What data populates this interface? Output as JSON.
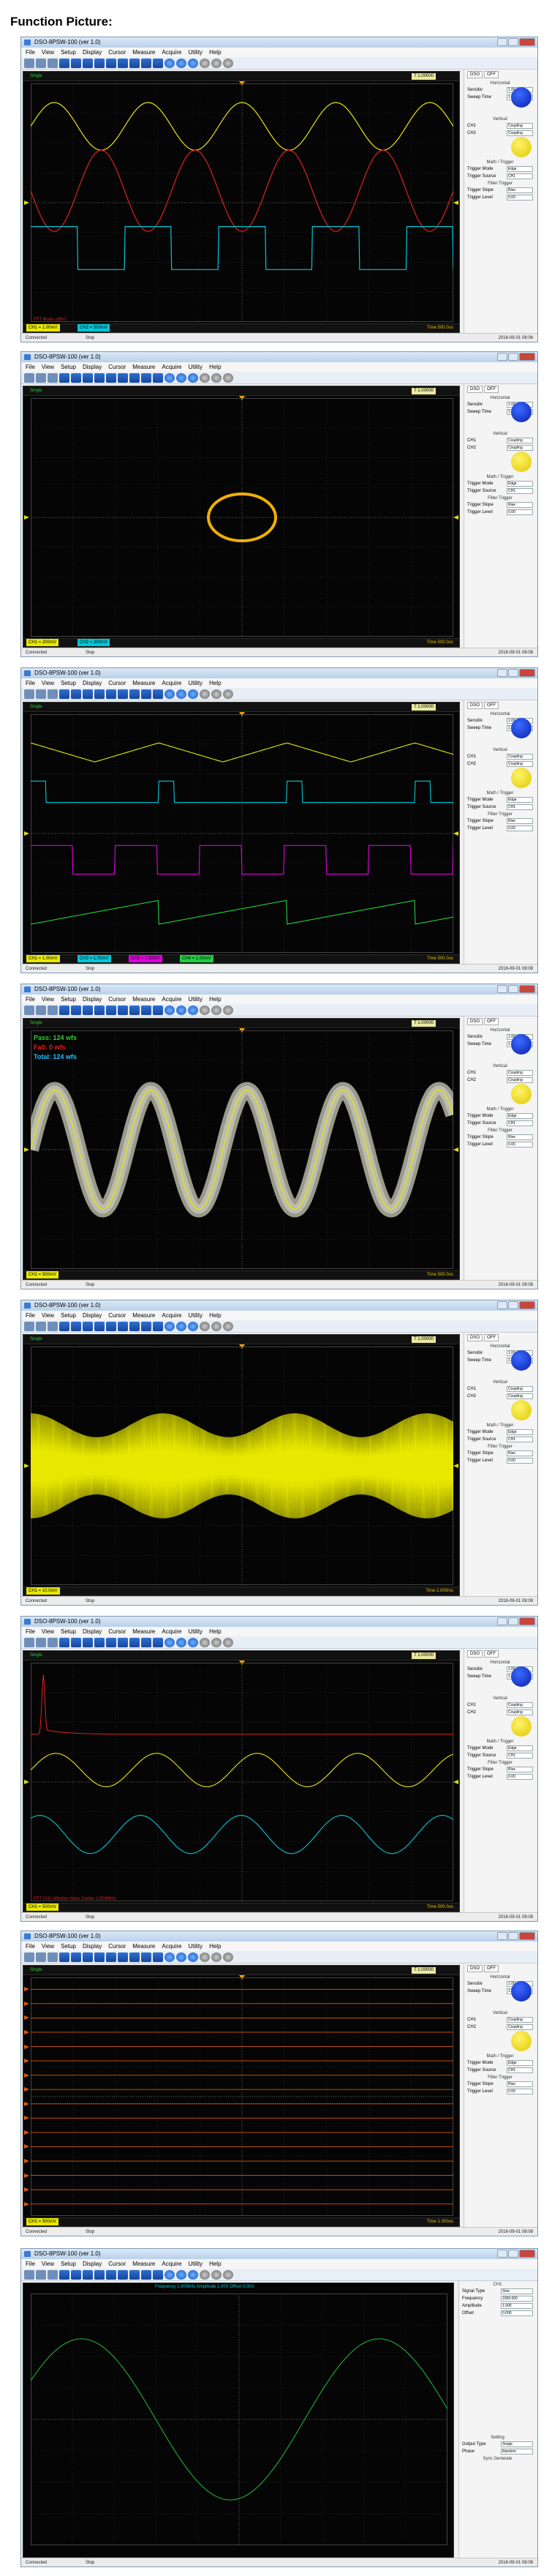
{
  "page": {
    "title": "Function Picture:"
  },
  "app": {
    "window_title": "DSO-8PSW-100 (ver 1.0)",
    "menu": [
      "File",
      "View",
      "Setup",
      "Display",
      "Cursor",
      "Measure",
      "Acquire",
      "Utility",
      "Help"
    ],
    "status": {
      "left": "Connected",
      "middle": "Stop",
      "right": "2016-09-01 08:08"
    },
    "panel": {
      "tabs": [
        "DSO",
        "OFF"
      ],
      "horizontal": "Horizontal",
      "sensitivity_label": "Sensitiv",
      "sensitivity_value": "1.00 us",
      "sweep_label": "Sweep Time",
      "sweep_value": "1.00us",
      "vertical": "Vertical",
      "ch1": "CH1",
      "ch2": "CH2",
      "coupling": "Coupling",
      "math": "Math / Trigger",
      "trigger_mode_label": "Trigger Mode",
      "trigger_mode_value": "Edge",
      "trigger_source_label": "Trigger Source",
      "trigger_source_value": "CH1",
      "filter": "Filter Trigger",
      "trigger_slope_label": "Trigger Slope",
      "trigger_slope_value": "Rise",
      "trigger_level_label": "Trigger Level",
      "trigger_level_value": "0.00"
    },
    "colors": {
      "ch1": "#e8e800",
      "ch2": "#00c8d8",
      "ch3": "#e000e0",
      "ch4": "#20d040",
      "red": "#e02020",
      "grid": "#3a3a3a",
      "digital": "#e05a00"
    }
  },
  "screens": [
    {
      "name": "multi-channel",
      "trig_mode": "Single",
      "trig_info": "T 1.00000",
      "ch1_label": "CH1 = 1.00mV",
      "ch2_label": "CH2 = 500mV",
      "time": "Time 500.0us",
      "overlay": "FFT Mode (dBV)"
    },
    {
      "name": "xy-mode",
      "trig_mode": "Single",
      "trig_info": "T 1.00000",
      "ch1_label": "CH1 = 200mV",
      "ch2_label": "CH2 = 200mV",
      "time": "Time 500.0us"
    },
    {
      "name": "four-channel",
      "trig_mode": "Single",
      "trig_info": "T 1.00000",
      "ch1_label": "CH1 = 1.00mV",
      "ch2_label": "CH2 = 1.00mV",
      "ch3_label": "CH3 = 1.00mV",
      "ch4_label": "CH4 = 1.00mV",
      "time": "Time 500.0us"
    },
    {
      "name": "persistence",
      "trig_mode": "Single",
      "trig_info": "T 1.00000",
      "ch1_label": "CH1 = 500mV",
      "time": "Time 500.0us",
      "meas1": "Pass: 124 wfs",
      "meas2": "Fail: 0 wfs",
      "meas3": "Total: 124 wfs"
    },
    {
      "name": "modulated",
      "trig_mode": "Single",
      "trig_info": "T 1.00000",
      "ch1_label": "CH1 = 10.0mV",
      "time": "Time 2.000ms"
    },
    {
      "name": "fft",
      "trig_mode": "Single",
      "trig_info": "T 1.00000",
      "ch1_label": "CH1 = 500mV",
      "time": "Time 500.0us",
      "overlay": "FFT CH1  Window Hann  Center 2.500MHz"
    },
    {
      "name": "logic",
      "trig_mode": "Single",
      "trig_info": "T 1.00000",
      "ch1_label": "CH1 = 500mV",
      "time": "Time 1.000us"
    },
    {
      "name": "generator",
      "gen_title": "Frequency 1.000kHz  Amplitude 1.00V  Offset 0.00V",
      "gen": {
        "ch": "CH1",
        "wave_label": "Signal Type",
        "wave_value": "Sine",
        "freq_label": "Frequency",
        "freq_value": "1000.000",
        "amp_label": "Amplitude",
        "amp_value": "1.000",
        "offset_label": "Offset",
        "offset_value": "0.000",
        "setting": "Setting",
        "output_label": "Output Type",
        "output_value": "Single",
        "phase_label": "Phase",
        "phase_value": "Random",
        "sync": "Sync Generate"
      }
    }
  ]
}
